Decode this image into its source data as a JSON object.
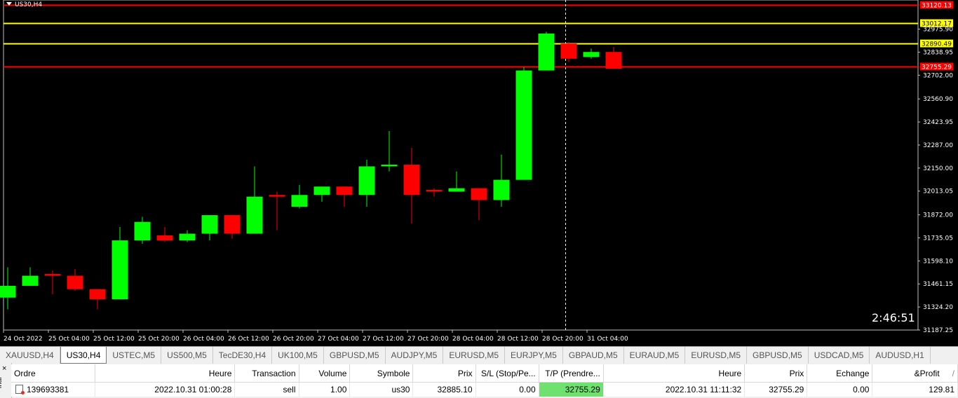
{
  "chart": {
    "symbol": "US30,H4",
    "timer": "2:46:51",
    "colors": {
      "bull": "#00ff00",
      "bear": "#ff0000",
      "background": "#000000",
      "grid_text": "#ffffff",
      "line_red": "#ff0000",
      "line_yellow": "#ffff00"
    },
    "y_axis": {
      "min": 31187.25,
      "max": 33149.0,
      "ticks": [
        "32975.90",
        "32838.95",
        "32702.00",
        "32560.90",
        "32423.95",
        "32287.00",
        "32150.00",
        "32013.05",
        "31872.00",
        "31735.05",
        "31598.10",
        "31461.15",
        "31324.20",
        "31187.25"
      ]
    },
    "x_labels": [
      "24 Oct 2022",
      "25 Oct 04:00",
      "25 Oct 12:00",
      "25 Oct 20:00",
      "26 Oct 04:00",
      "26 Oct 12:00",
      "26 Oct 20:00",
      "27 Oct 04:00",
      "27 Oct 12:00",
      "27 Oct 20:00",
      "28 Oct 04:00",
      "28 Oct 12:00",
      "28 Oct 20:00",
      "31 Oct 04:00"
    ],
    "horizontal_lines": [
      {
        "price": 33120.13,
        "label": "33120.13",
        "color": "red"
      },
      {
        "price": 33012.17,
        "label": "33012.17",
        "color": "yellow"
      },
      {
        "price": 32890.49,
        "label": "32890.49",
        "color": "yellow"
      },
      {
        "price": 32755.29,
        "label": "32755.29",
        "color": "red"
      }
    ]
  },
  "chart_data": {
    "type": "candlestick",
    "title": "US30,H4",
    "ylim": [
      31187.25,
      33149.0
    ],
    "candles": [
      {
        "o": 31380,
        "h": 31560,
        "l": 31310,
        "c": 31450
      },
      {
        "o": 31450,
        "h": 31560,
        "l": 31450,
        "c": 31510
      },
      {
        "o": 31520,
        "h": 31540,
        "l": 31400,
        "c": 31510
      },
      {
        "o": 31510,
        "h": 31550,
        "l": 31420,
        "c": 31430
      },
      {
        "o": 31430,
        "h": 31430,
        "l": 31310,
        "c": 31370
      },
      {
        "o": 31370,
        "h": 31800,
        "l": 31370,
        "c": 31720
      },
      {
        "o": 31720,
        "h": 31860,
        "l": 31700,
        "c": 31830
      },
      {
        "o": 31750,
        "h": 31800,
        "l": 31710,
        "c": 31720
      },
      {
        "o": 31720,
        "h": 31780,
        "l": 31710,
        "c": 31760
      },
      {
        "o": 31760,
        "h": 31870,
        "l": 31720,
        "c": 31870
      },
      {
        "o": 31870,
        "h": 31870,
        "l": 31730,
        "c": 31760
      },
      {
        "o": 31760,
        "h": 32160,
        "l": 31760,
        "c": 31980
      },
      {
        "o": 31990,
        "h": 32010,
        "l": 31780,
        "c": 31980
      },
      {
        "o": 31920,
        "h": 32050,
        "l": 31910,
        "c": 31990
      },
      {
        "o": 31990,
        "h": 32040,
        "l": 31950,
        "c": 32040
      },
      {
        "o": 32040,
        "h": 32040,
        "l": 31920,
        "c": 31990
      },
      {
        "o": 31990,
        "h": 32200,
        "l": 31920,
        "c": 32160
      },
      {
        "o": 32160,
        "h": 32370,
        "l": 32130,
        "c": 32170
      },
      {
        "o": 32170,
        "h": 32270,
        "l": 31820,
        "c": 31990
      },
      {
        "o": 32020,
        "h": 32030,
        "l": 31980,
        "c": 32010
      },
      {
        "o": 32010,
        "h": 32130,
        "l": 32010,
        "c": 32030
      },
      {
        "o": 32030,
        "h": 32030,
        "l": 31840,
        "c": 31960
      },
      {
        "o": 31960,
        "h": 32230,
        "l": 31920,
        "c": 32080
      },
      {
        "o": 32080,
        "h": 32750,
        "l": 32080,
        "c": 32730
      },
      {
        "o": 32730,
        "h": 32960,
        "l": 32730,
        "c": 32950
      },
      {
        "o": 32890,
        "h": 32900,
        "l": 32780,
        "c": 32800
      },
      {
        "o": 32810,
        "h": 32860,
        "l": 32800,
        "c": 32840
      },
      {
        "o": 32840,
        "h": 32870,
        "l": 32750,
        "c": 32740
      }
    ]
  },
  "tabs": [
    {
      "label": "XAUUSD,H4",
      "active": false
    },
    {
      "label": "US30,H4",
      "active": true
    },
    {
      "label": "USTEC,M5",
      "active": false
    },
    {
      "label": "US500,M5",
      "active": false
    },
    {
      "label": "TecDE30,H4",
      "active": false
    },
    {
      "label": "UK100,M5",
      "active": false
    },
    {
      "label": "GBPUSD,M5",
      "active": false
    },
    {
      "label": "AUDJPY,M5",
      "active": false
    },
    {
      "label": "EURUSD,M5",
      "active": false
    },
    {
      "label": "EURJPY,M5",
      "active": false
    },
    {
      "label": "GBPAUD,M5",
      "active": false
    },
    {
      "label": "EURAUD,M5",
      "active": false
    },
    {
      "label": "EURUSD,M5",
      "active": false
    },
    {
      "label": "GBPUSD,M5",
      "active": false
    },
    {
      "label": "USDCAD,M5",
      "active": false
    },
    {
      "label": "AUDUSD,H1",
      "active": false
    }
  ],
  "terminal": {
    "close": "×",
    "side_label": "inal",
    "headers": {
      "order": "Ordre",
      "time": "Heure",
      "type": "Transaction",
      "volume": "Volume",
      "symbol": "Symbole",
      "price": "Prix",
      "sl": "S/L (Stop/Pe...",
      "tp": "T/P (Prendre...",
      "time2": "Heure",
      "price2": "Prix",
      "swap": "Echange",
      "profit": "&Profit",
      "sort": "/"
    },
    "row": {
      "order": "139693381",
      "time": "2022.10.31 01:00:28",
      "type": "sell",
      "volume": "1.00",
      "symbol": "us30",
      "price": "32885.10",
      "sl": "0.00",
      "tp": "32755.29",
      "time2": "2022.10.31 11:11:32",
      "price2": "32755.29",
      "swap": "0.00",
      "profit": "129.81"
    }
  }
}
